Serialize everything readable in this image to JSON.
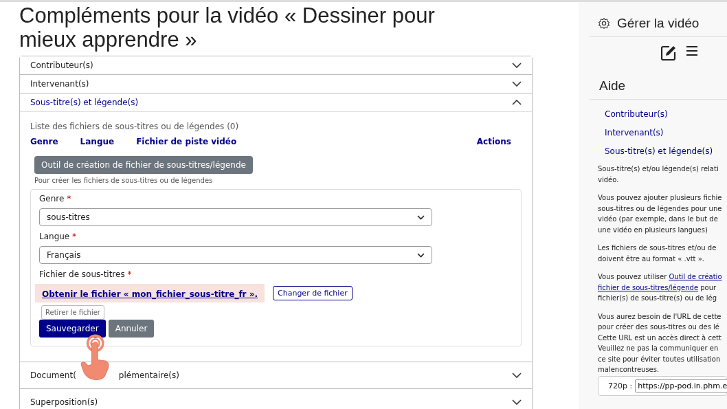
{
  "page_title": "Compléments pour la vidéo « Dessiner pour mieux apprendre »",
  "accordion": [
    {
      "label": "Contributeur(s)",
      "expanded": false
    },
    {
      "label": "Intervenant(s)",
      "expanded": false
    },
    {
      "label": "Sous-titre(s) et légende(s)",
      "expanded": true,
      "list_title": "Liste des fichiers de sous-titres ou de légendes (0)",
      "columns": [
        "Genre",
        "Langue",
        "Fichier de piste vidéo",
        "Actions"
      ],
      "tool_button": "Outil de création de fichier de sous-titres/légende",
      "tool_help": "Pour créer les fichiers de sous-titres ou de légendes",
      "form": {
        "fields": [
          {
            "label": "Genre",
            "required_mark": "*",
            "value": "sous-titres"
          },
          {
            "label": "Langue",
            "required_mark": "*",
            "value": "Français"
          }
        ],
        "file_label": "Fichier de sous-titres",
        "file_required_mark": "*",
        "file_link": "Obtenir le fichier « mon_fichier_sous-titre_fr ».",
        "change_button": "Changer de fichier",
        "remove_button": "Retirer le fichier",
        "buttons": [
          "Sauvegarder",
          "Annuler"
        ]
      }
    },
    {
      "label": "Document(",
      "label_after_cover": "plémentaire(s)",
      "expanded": false
    },
    {
      "label": "Superposition(s)",
      "expanded": false
    }
  ],
  "sidebar": {
    "title": "Gérer la vidéo",
    "help_title": "Aide",
    "links": [
      "Contributeur(s)",
      "Intervenant(s)",
      "Sous-titre(s) et légende(s)"
    ],
    "paragraphs": [
      {
        "kind": "text",
        "lines": [
          "Sous-titre(s) et/ou légende(s) relati",
          "vidéo."
        ]
      },
      {
        "kind": "text",
        "lines": [
          "Vous pouvez ajouter plusieurs fichie",
          "sous-titres ou de légendes pour une",
          "vidéo (par exemple, dans le but de",
          "une vidéo en plusieurs langues)"
        ]
      },
      {
        "kind": "text",
        "lines": [
          "Les fichiers de sous-titres et/ou de",
          "doivent être au format « .vtt »."
        ]
      },
      {
        "kind": "link",
        "before": "Vous pouvez utiliser ",
        "link_lines": [
          "Outil de créatio",
          "fichier de sous-titres/légende"
        ],
        "after": " pour",
        "lines": [
          "fichier(s) de sous-titre(s) ou de lég"
        ]
      },
      {
        "kind": "text",
        "lines": [
          "Vous aurez besoin de l'URL de cette",
          "pour créer des sous-titres ou des lé",
          "Cette URL est un accès direct à cett",
          "Veuillez ne pas la communiquer en",
          "ce site pour éviter toutes utilisation",
          "malencontreuses."
        ]
      }
    ],
    "url_label": "720p :",
    "url_value": "https://pp-pod.in.phm.e"
  }
}
